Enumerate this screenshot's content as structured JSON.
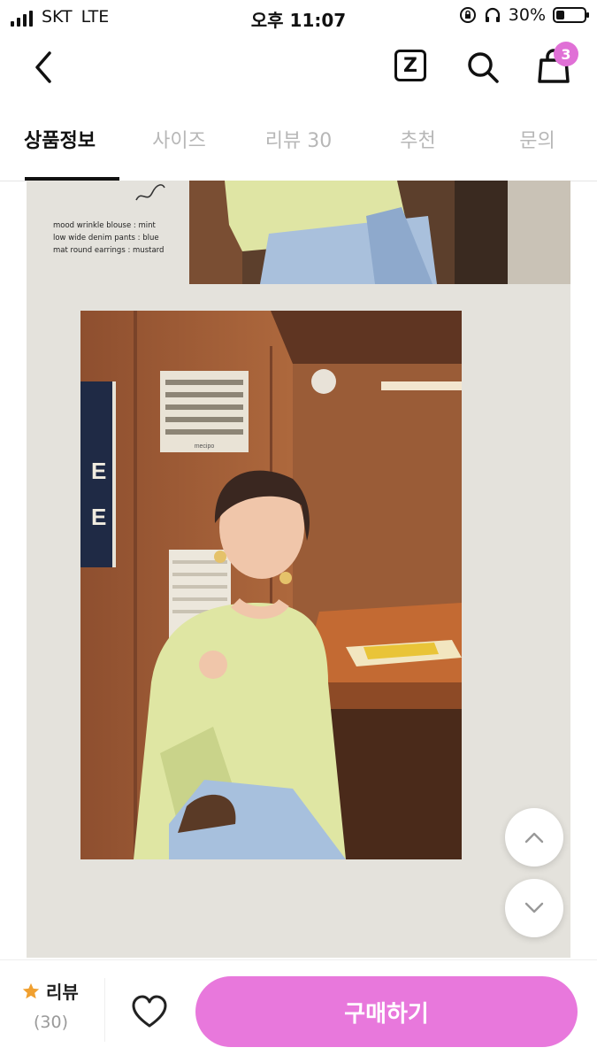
{
  "status_bar": {
    "carrier": "SKT",
    "network": "LTE",
    "time": "오후 11:07",
    "battery_percent": "30%",
    "battery_level": 0.3
  },
  "nav": {
    "back_icon": "chevron-left-icon",
    "z_label": "Z",
    "search_icon": "search-icon",
    "cart_icon": "shopping-bag-icon",
    "cart_badge": "3",
    "badge_color": "#e070d6"
  },
  "tabs": [
    {
      "label": "상품정보",
      "active": true
    },
    {
      "label": "사이즈",
      "active": false
    },
    {
      "label": "리뷰 30",
      "active": false
    },
    {
      "label": "추천",
      "active": false
    },
    {
      "label": "문의",
      "active": false
    }
  ],
  "content": {
    "caption_lines": [
      "mood wrinkle blouse : mint",
      "low wide denim pants : blue",
      "mat round earrings : mustard"
    ],
    "poster_letters": [
      "E",
      "E"
    ],
    "vent_label": "mecipo"
  },
  "scroll_buttons": {
    "up_icon": "chevron-up-icon",
    "down_icon": "chevron-down-icon"
  },
  "bottom_bar": {
    "review_label": "리뷰",
    "review_count": "(30)",
    "star_color": "#f0a030",
    "wishlist_icon": "heart-icon",
    "buy_label": "구매하기",
    "buy_color": "#e878dc"
  }
}
